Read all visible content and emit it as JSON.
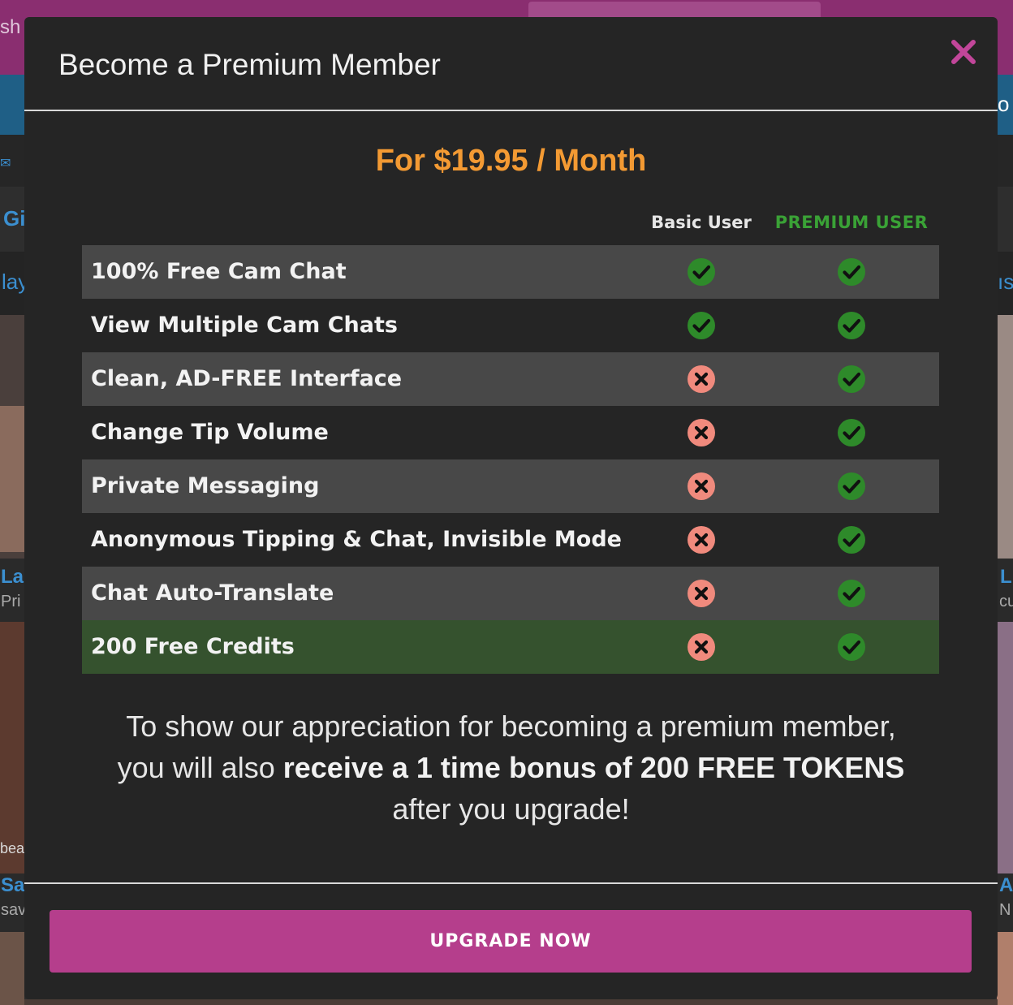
{
  "background": {
    "fragments": [
      "sh",
      "Gi",
      "lay",
      "La",
      "Pri",
      "bea",
      "Sa",
      "sav",
      "o",
      "ıs",
      "L",
      "cu",
      "A",
      "N"
    ]
  },
  "modal": {
    "title": "Become a Premium Member",
    "price": "For $19.95 / Month",
    "columns": {
      "basic": "Basic User",
      "premium": "PREMIUM USER"
    },
    "features": [
      {
        "label": "100% Free Cam Chat",
        "basic": "check",
        "premium": "check"
      },
      {
        "label": "View Multiple Cam Chats",
        "basic": "check",
        "premium": "check"
      },
      {
        "label": "Clean, AD-FREE Interface",
        "basic": "cross",
        "premium": "check"
      },
      {
        "label": "Change Tip Volume",
        "basic": "cross",
        "premium": "check"
      },
      {
        "label": "Private Messaging",
        "basic": "cross",
        "premium": "check"
      },
      {
        "label": "Anonymous Tipping & Chat, Invisible Mode",
        "basic": "cross",
        "premium": "check"
      },
      {
        "label": "Chat Auto-Translate",
        "basic": "cross",
        "premium": "check"
      },
      {
        "label": "200 Free Credits",
        "basic": "cross",
        "premium": "check",
        "highlight": true
      }
    ],
    "footer": {
      "line1": "To show our appreciation for becoming a premium member,",
      "line2_pre": "you will also",
      "line2_bold": "receive a 1 time bonus of 200 FREE TOKENS",
      "line3": "after you upgrade!"
    },
    "cta": "UPGRADE NOW"
  },
  "colors": {
    "accent": "#b53e8c",
    "price": "#f39a33",
    "premium": "#3aa236",
    "check": "#2e8a2a",
    "cross": "#f08a7d",
    "highlight_row": "#35522e"
  }
}
